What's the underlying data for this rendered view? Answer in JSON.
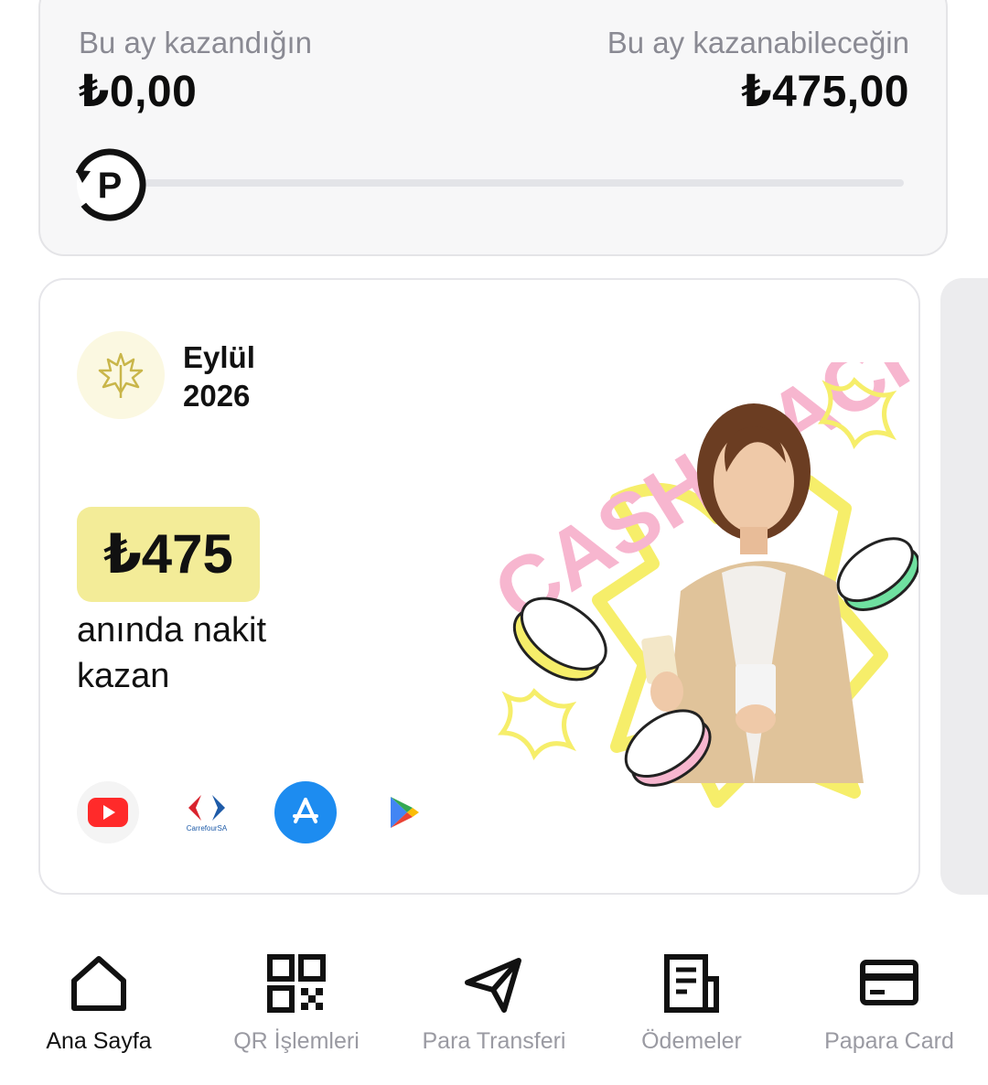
{
  "earnings": {
    "earned_label": "Bu ay kazandığın",
    "earned_value": "₺0,00",
    "potential_label": "Bu ay kazanabileceğin",
    "potential_value": "₺475,00",
    "progress_fraction": 0
  },
  "promo": {
    "month_line1": "Eylül",
    "month_line2": "2026",
    "amount": "₺475",
    "description_line1": "anında nakit",
    "description_line2": "kazan",
    "hero_text": "CASH BACK",
    "brands": [
      "youtube-logo",
      "carrefoursa-logo",
      "app-store-logo",
      "google-play-logo"
    ],
    "brand_carrefour_text": "CarrefourSA"
  },
  "nav": {
    "items": [
      {
        "label": "Ana Sayfa",
        "icon": "home-icon",
        "active": true
      },
      {
        "label": "QR İşlemleri",
        "icon": "qr-icon",
        "active": false
      },
      {
        "label": "Para Transferi",
        "icon": "send-icon",
        "active": false
      },
      {
        "label": "Ödemeler",
        "icon": "bill-icon",
        "active": false
      },
      {
        "label": "Papara Card",
        "icon": "card-icon",
        "active": false
      }
    ]
  },
  "colors": {
    "accent_yellow": "#f3ec98",
    "muted_text": "#8a8a93",
    "card_bg": "#f7f7f8"
  }
}
